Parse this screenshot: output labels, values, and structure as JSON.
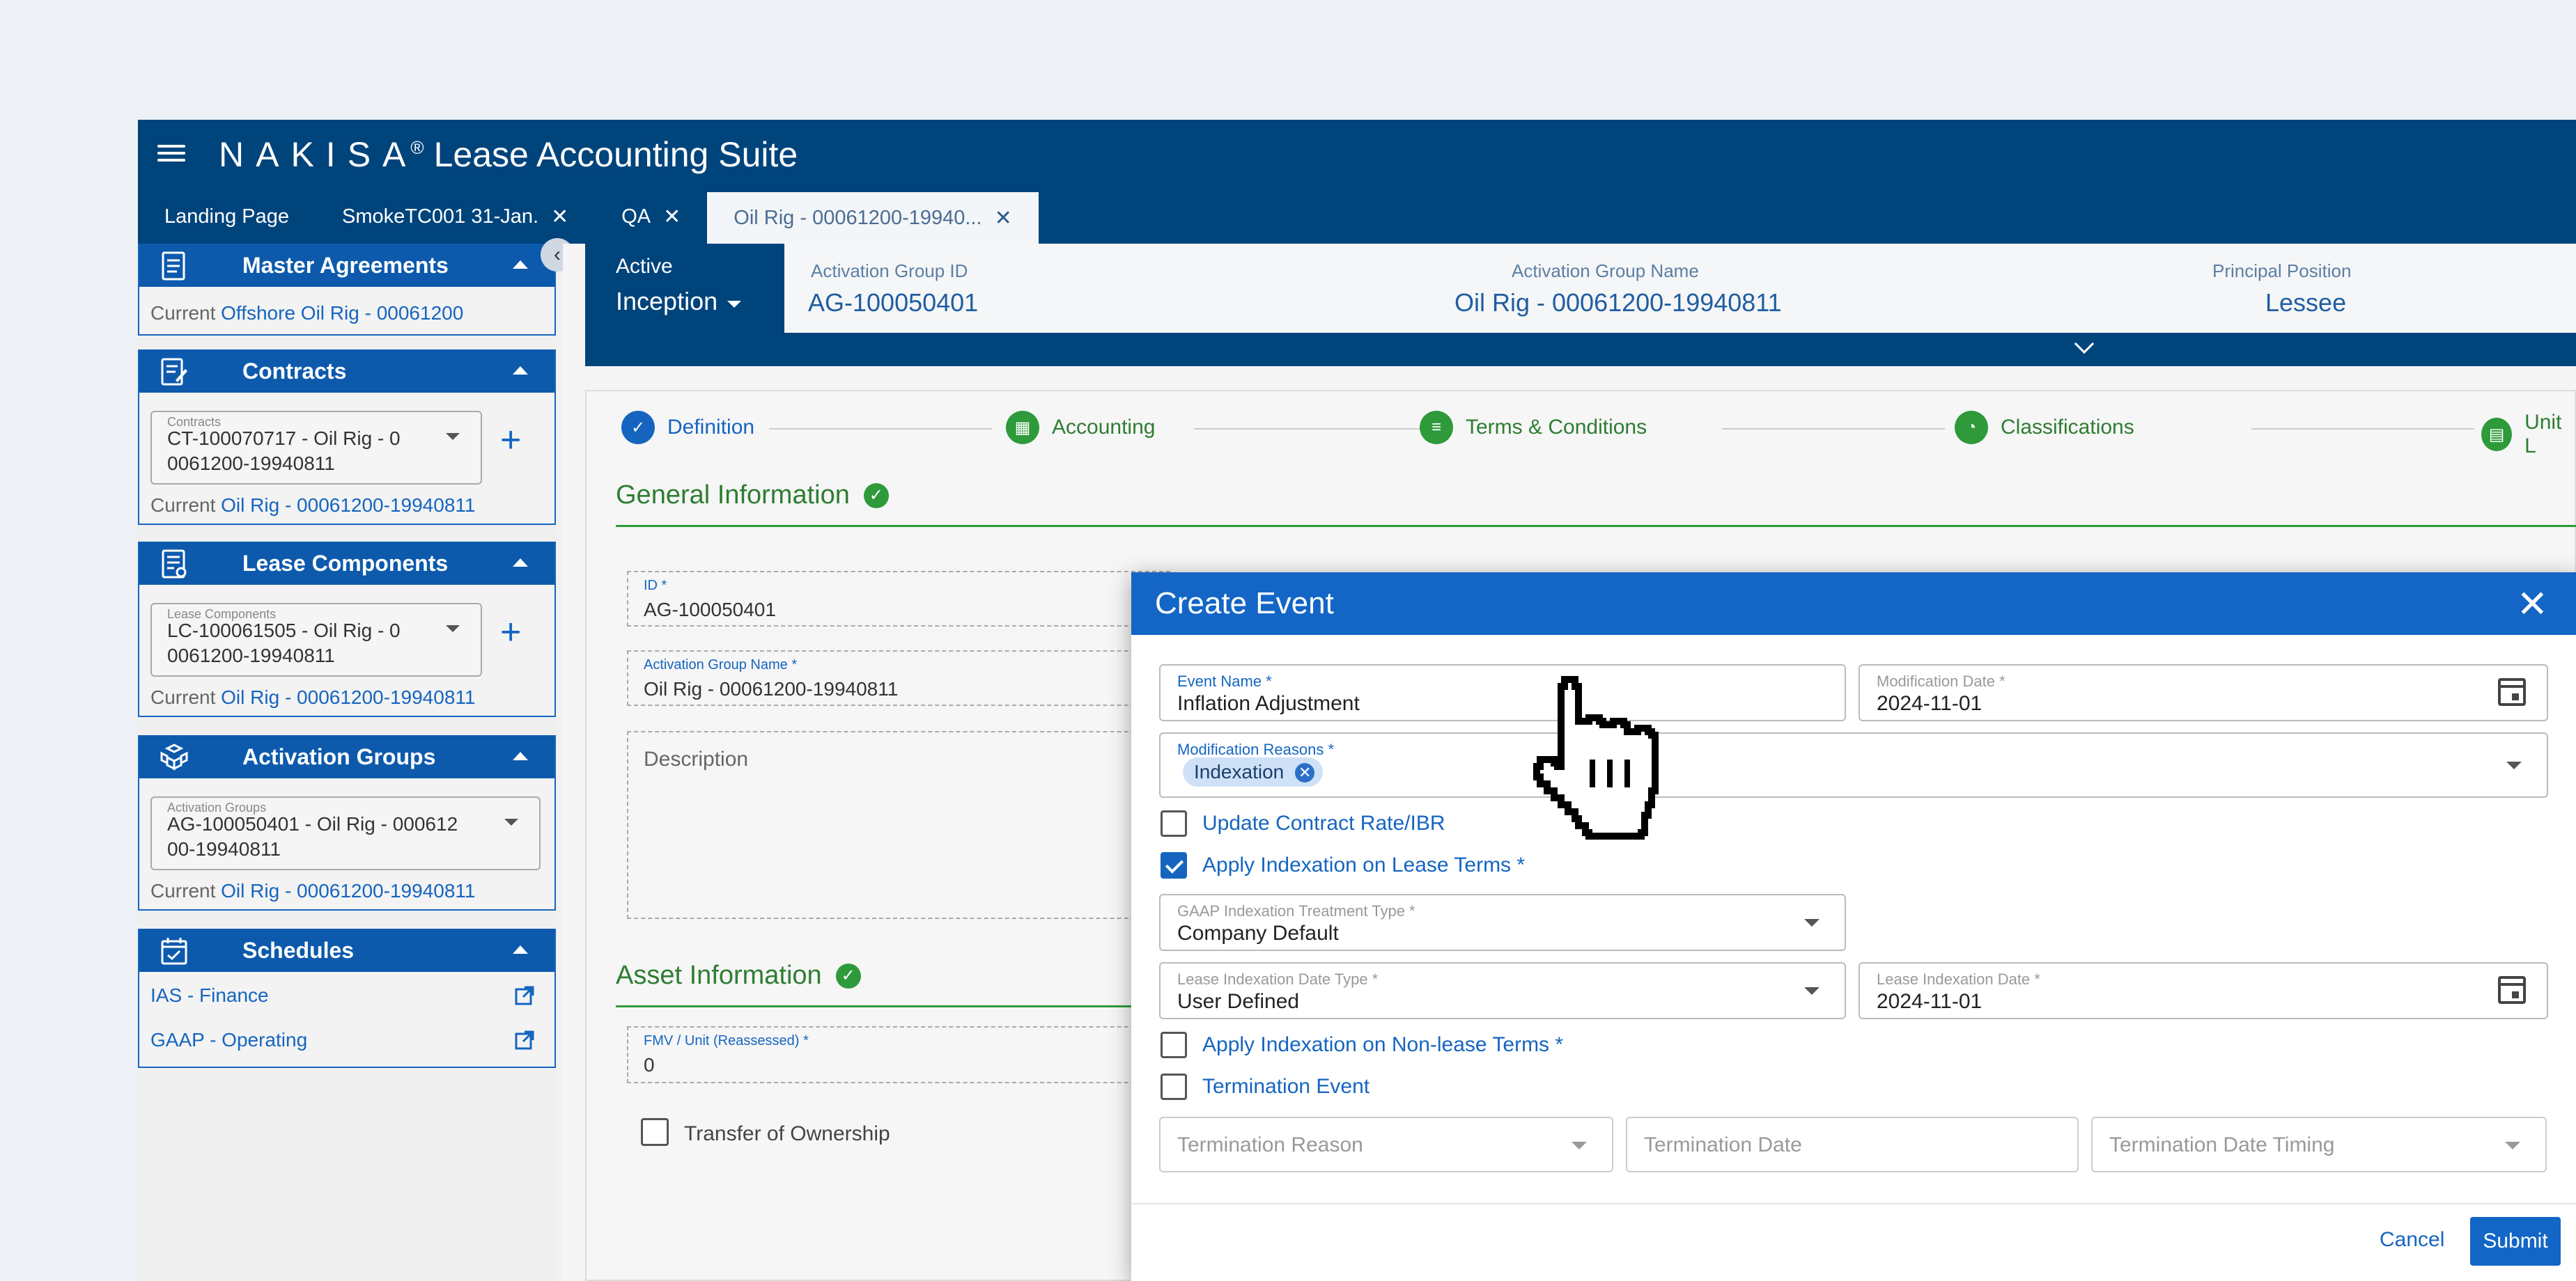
{
  "header": {
    "brand": "NAKISA",
    "registered": "®",
    "suite": "Lease Accounting Suite"
  },
  "tabs": [
    {
      "label": "Landing Page",
      "closable": false
    },
    {
      "label": "SmokeTC001 31-Jan.",
      "closable": true
    },
    {
      "label": "QA",
      "closable": true
    },
    {
      "label": "Oil Rig - 00061200-19940...",
      "closable": true,
      "active": true
    }
  ],
  "sidebar": {
    "master_agreements": {
      "title": "Master Agreements",
      "current_label": "Current",
      "current_value": "Offshore Oil Rig - 00061200"
    },
    "contracts": {
      "title": "Contracts",
      "field_label": "Contracts",
      "value_line1": "CT-100070717 - Oil Rig - 0",
      "value_line2": "0061200-19940811",
      "current_label": "Current",
      "current_value": "Oil Rig - 00061200-19940811"
    },
    "lease_components": {
      "title": "Lease Components",
      "field_label": "Lease Components",
      "value_line1": "LC-100061505 - Oil Rig - 0",
      "value_line2": "0061200-19940811",
      "current_label": "Current",
      "current_value": "Oil Rig - 00061200-19940811"
    },
    "activation_groups": {
      "title": "Activation Groups",
      "field_label": "Activation Groups",
      "value_line1": "AG-100050401 - Oil Rig - 000612",
      "value_line2": "00-19940811",
      "current_label": "Current",
      "current_value": "Oil Rig - 00061200-19940811"
    },
    "schedules": {
      "title": "Schedules",
      "items": [
        "IAS - Finance",
        "GAAP - Operating"
      ]
    }
  },
  "info_bar": {
    "status": "Active",
    "phase": "Inception",
    "group_id_label": "Activation Group ID",
    "group_id": "AG-100050401",
    "group_name_label": "Activation Group Name",
    "group_name": "Oil Rig - 00061200-19940811",
    "position_label": "Principal Position",
    "position": "Lessee"
  },
  "steps": [
    "Definition",
    "Accounting",
    "Terms & Conditions",
    "Classifications",
    "Unit L"
  ],
  "general_info": {
    "title": "General Information",
    "id_label": "ID *",
    "id_value": "AG-100050401",
    "name_label": "Activation Group Name *",
    "name_value": "Oil Rig - 00061200-19940811",
    "description_placeholder": "Description"
  },
  "asset_info": {
    "title": "Asset Information",
    "fmv_label": "FMV / Unit (Reassessed) *",
    "fmv_value": "0",
    "transfer_label": "Transfer of Ownership"
  },
  "modal": {
    "title": "Create Event",
    "event_name_label": "Event Name *",
    "event_name": "Inflation Adjustment",
    "mod_date_label": "Modification Date *",
    "mod_date": "2024-11-01",
    "mod_reasons_label": "Modification Reasons *",
    "mod_reason_chip": "Indexation",
    "update_rate_label": "Update Contract Rate/IBR",
    "update_rate_checked": false,
    "apply_index_label": "Apply Indexation on Lease Terms *",
    "apply_index_checked": true,
    "gaap_label": "GAAP Indexation Treatment Type *",
    "gaap_value": "Company Default",
    "idx_date_type_label": "Lease Indexation Date Type *",
    "idx_date_type": "User Defined",
    "idx_date_label": "Lease Indexation Date *",
    "idx_date": "2024-11-01",
    "nonlease_label": "Apply Indexation on Non-lease Terms *",
    "nonlease_checked": false,
    "termination_label": "Termination Event",
    "termination_checked": false,
    "term_reason_placeholder": "Termination Reason",
    "term_date_placeholder": "Termination Date",
    "term_timing_placeholder": "Termination Date Timing",
    "cancel": "Cancel",
    "submit": "Submit"
  },
  "colors": {
    "header": "#00447c",
    "accent": "#1366c6",
    "success": "#2e9a3a"
  }
}
